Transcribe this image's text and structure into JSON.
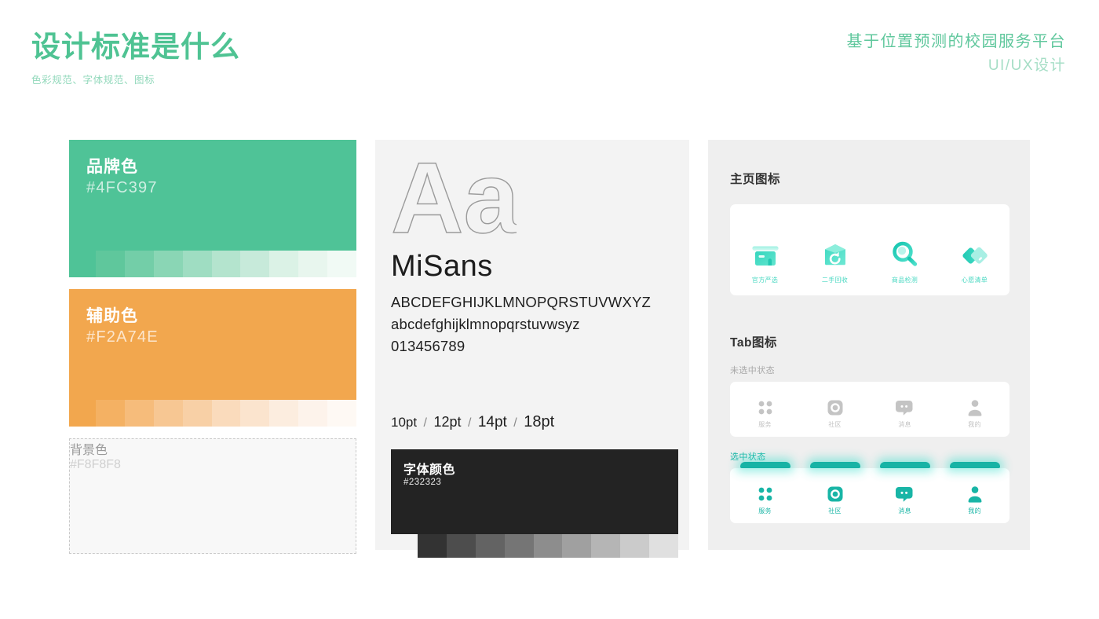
{
  "header": {
    "title": "设计标准是什么",
    "subtitle": "色彩规范、字体规范、图标",
    "right_line1": "基于位置预测的校园服务平台",
    "right_line2": "UI/UX设计"
  },
  "colors": {
    "brand": {
      "label": "品牌色",
      "hex": "#4FC397",
      "tints": [
        "#5FC79C",
        "#73CEA8",
        "#8AD6B5",
        "#9FDDC2",
        "#B4E4CE",
        "#C7EADA",
        "#DBF2E6",
        "#E8F6EE",
        "#F1FAF5"
      ]
    },
    "assist": {
      "label": "辅助色",
      "hex": "#F2A74E",
      "tints": [
        "#F4B163",
        "#F6BC7B",
        "#F7C793",
        "#F8D0A6",
        "#FADBBC",
        "#FBE4CE",
        "#FCEDDF",
        "#FDF3EB",
        "#FEF9F4"
      ]
    },
    "background": {
      "label": "背景色",
      "hex": "#F8F8F8"
    },
    "text": {
      "label": "字体颜色",
      "hex": "#232323",
      "tints": [
        "#333333",
        "#4D4D4D",
        "#636363",
        "#757575",
        "#8D8D8D",
        "#A0A0A0",
        "#B5B5B5",
        "#CBCBCB",
        "#E0E0E0"
      ]
    }
  },
  "typography": {
    "glyph_sample": "Aa",
    "font_name": "MiSans",
    "uppercase": "ABCDEFGHIJKLMNOPQRSTUVWXYZ",
    "lowercase": "abcdefghijklmnopqrstuvwsyz",
    "digits": "013456789",
    "sizes": [
      "10pt",
      "12pt",
      "14pt",
      "18pt"
    ],
    "size_separator": "/"
  },
  "icons": {
    "home_section_title": "主页图标",
    "home_icons": [
      {
        "name": "storefront-icon",
        "label": "官方严选"
      },
      {
        "name": "recycle-box-icon",
        "label": "二手回收"
      },
      {
        "name": "magnifier-icon",
        "label": "商品检测"
      },
      {
        "name": "wishlist-cards-icon",
        "label": "心愿清单"
      }
    ],
    "tab_section_title": "Tab图标",
    "unselected_state_label": "未选中状态",
    "selected_state_label": "选中状态",
    "tabs": [
      {
        "name": "grid-dots-icon",
        "label": "服务"
      },
      {
        "name": "aperture-icon",
        "label": "社区"
      },
      {
        "name": "chat-bubble-icon",
        "label": "消息"
      },
      {
        "name": "person-icon",
        "label": "我的"
      }
    ]
  }
}
